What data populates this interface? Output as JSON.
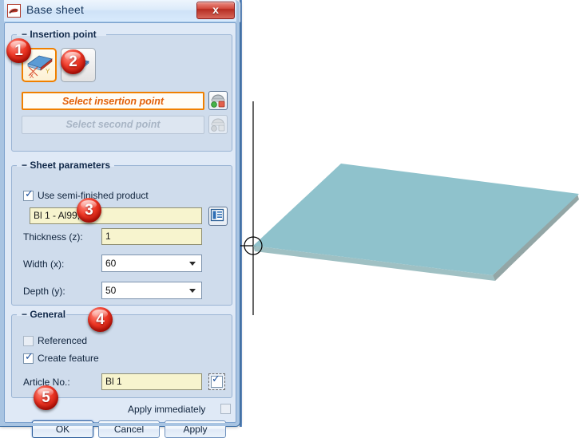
{
  "window": {
    "title": "Base sheet",
    "app_icon": "app-logo-icon",
    "close_label": "x"
  },
  "groups": {
    "insertion": {
      "title": "Insertion point",
      "buttons": [
        {
          "name": "insertion-corner-xy-icon",
          "selected": true
        },
        {
          "name": "insertion-center-icon",
          "selected": false
        }
      ],
      "select_insertion_point": "Select insertion point",
      "select_second_point": "Select second point",
      "pick_icon_1": "pick-point-icon",
      "pick_icon_2": "pick-second-point-icon"
    },
    "sheet": {
      "title": "Sheet parameters",
      "use_semi_finished": {
        "label": "Use semi-finished product",
        "checked": true
      },
      "product_value": "Bl 1 - Al99,0",
      "product_browse_icon": "catalog-browse-icon",
      "thickness": {
        "label": "Thickness (z):",
        "value": "1"
      },
      "width": {
        "label": "Width (x):",
        "value": "60"
      },
      "depth": {
        "label": "Depth (y):",
        "value": "50"
      }
    },
    "general": {
      "title": "General",
      "referenced": {
        "label": "Referenced",
        "checked": false
      },
      "create_feature": {
        "label": "Create feature",
        "checked": true
      },
      "article_no": {
        "label": "Article No.:",
        "value": "Bl 1",
        "toggle_checked": true
      }
    }
  },
  "footer": {
    "apply_immediately": {
      "label": "Apply immediately",
      "checked": false
    },
    "ok": "OK",
    "cancel": "Cancel",
    "apply": "Apply"
  },
  "callouts": [
    {
      "n": "1"
    },
    {
      "n": "2"
    },
    {
      "n": "3"
    },
    {
      "n": "4"
    },
    {
      "n": "5"
    }
  ],
  "viewport": {
    "name": "cad-3d-viewport",
    "sheet_face_color": "#8fc2cc",
    "sheet_edge_color": "#98a8a8",
    "origin_marker": "origin-crosshair-icon"
  }
}
